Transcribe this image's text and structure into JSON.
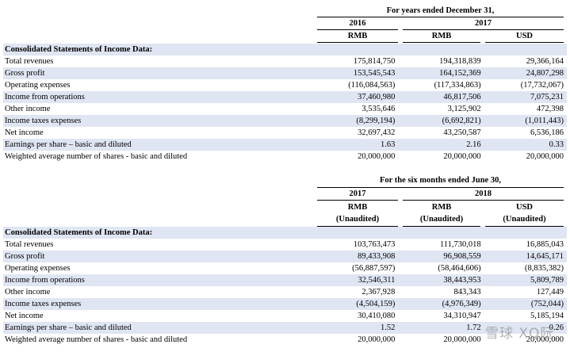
{
  "section1": {
    "period_title": "For years ended December 31,",
    "year_a": "2016",
    "year_b": "2017",
    "currencies": [
      "RMB",
      "RMB",
      "USD"
    ],
    "heading": "Consolidated Statements of Income Data:",
    "rows": [
      {
        "label": "Total revenues",
        "v1": "175,814,750",
        "v2": "194,318,839",
        "v3": "29,366,164"
      },
      {
        "label": "Gross profit",
        "v1": "153,545,543",
        "v2": "164,152,369",
        "v3": "24,807,298"
      },
      {
        "label": "Operating expenses",
        "v1": "(116,084,563)",
        "v2": "(117,334,863)",
        "v3": "(17,732,067)"
      },
      {
        "label": "Income from operations",
        "v1": "37,460,980",
        "v2": "46,817,506",
        "v3": "7,075,231"
      },
      {
        "label": "Other income",
        "v1": "3,535,646",
        "v2": "3,125,902",
        "v3": "472,398"
      },
      {
        "label": "Income taxes expenses",
        "v1": "(8,299,194)",
        "v2": "(6,692,821)",
        "v3": "(1,011,443)"
      },
      {
        "label": "Net income",
        "v1": "32,697,432",
        "v2": "43,250,587",
        "v3": "6,536,186"
      },
      {
        "label": "Earnings per share – basic and diluted",
        "v1": "1.63",
        "v2": "2.16",
        "v3": "0.33"
      },
      {
        "label": "Weighted average number of shares - basic and diluted",
        "v1": "20,000,000",
        "v2": "20,000,000",
        "v3": "20,000,000"
      }
    ]
  },
  "section2": {
    "period_title": "For the six months ended June 30,",
    "year_a": "2017",
    "year_b": "2018",
    "currencies": [
      "RMB",
      "RMB",
      "USD"
    ],
    "audit_note": [
      "(Unaudited)",
      "(Unaudited)",
      "(Unaudited)"
    ],
    "heading": "Consolidated Statements of Income Data:",
    "rows": [
      {
        "label": "Total revenues",
        "v1": "103,763,473",
        "v2": "111,730,018",
        "v3": "16,885,043"
      },
      {
        "label": "Gross profit",
        "v1": "89,433,908",
        "v2": "96,908,559",
        "v3": "14,645,171"
      },
      {
        "label": "Operating expenses",
        "v1": "(56,887,597)",
        "v2": "(58,464,606)",
        "v3": "(8,835,382)"
      },
      {
        "label": "Income from operations",
        "v1": "32,546,311",
        "v2": "38,443,953",
        "v3": "5,809,789"
      },
      {
        "label": "Other income",
        "v1": "2,367,928",
        "v2": "843,343",
        "v3": "127,449"
      },
      {
        "label": "Income taxes expenses",
        "v1": "(4,504,159)",
        "v2": "(4,976,349)",
        "v3": "(752,044)"
      },
      {
        "label": "Net income",
        "v1": "30,410,080",
        "v2": "34,310,947",
        "v3": "5,185,194"
      },
      {
        "label": "Earnings per share – basic and diluted",
        "v1": "1.52",
        "v2": "1.72",
        "v3": "0.26"
      },
      {
        "label": "Weighted average number of shares - basic and diluted",
        "v1": "20,000,000",
        "v2": "20,000,000",
        "v3": "20,000,000"
      }
    ]
  },
  "watermark": "雪球 XQ阮",
  "colors": {
    "row_shade": "#dfe5f2",
    "text": "#000000"
  }
}
